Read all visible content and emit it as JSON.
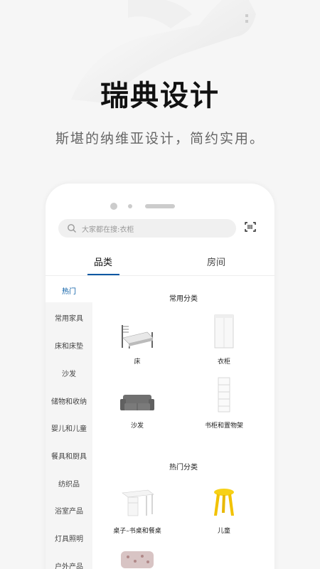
{
  "hero": {
    "title": "瑞典设计",
    "subtitle": "斯堪的纳维亚设计，简约实用。"
  },
  "search": {
    "placeholder": "大家都在搜:衣柜"
  },
  "tabs": [
    {
      "label": "品类",
      "active": true
    },
    {
      "label": "房间",
      "active": false
    }
  ],
  "sidebar": {
    "items": [
      {
        "label": "热门",
        "active": true
      },
      {
        "label": "常用家具"
      },
      {
        "label": "床和床垫"
      },
      {
        "label": "沙发"
      },
      {
        "label": "储物和收纳"
      },
      {
        "label": "婴儿和儿童"
      },
      {
        "label": "餐具和厨具"
      },
      {
        "label": "纺织品"
      },
      {
        "label": "浴室产品"
      },
      {
        "label": "灯具照明"
      },
      {
        "label": "户外产品"
      }
    ]
  },
  "sections": {
    "common": {
      "title": "常用分类",
      "products": [
        {
          "label": "床",
          "icon": "bed-image"
        },
        {
          "label": "衣柜",
          "icon": "wardrobe-image"
        },
        {
          "label": "沙发",
          "icon": "sofa-image"
        },
        {
          "label": "书柜和置物架",
          "icon": "bookshelf-image"
        }
      ]
    },
    "hot": {
      "title": "热门分类",
      "products": [
        {
          "label": "桌子–书桌和餐桌",
          "icon": "desk-image"
        },
        {
          "label": "儿童",
          "icon": "kids-stool-image"
        }
      ]
    }
  },
  "colors": {
    "accent": "#0058a3",
    "sidebar_bg": "#f5f5f5",
    "stool_yellow": "#f7d117"
  }
}
